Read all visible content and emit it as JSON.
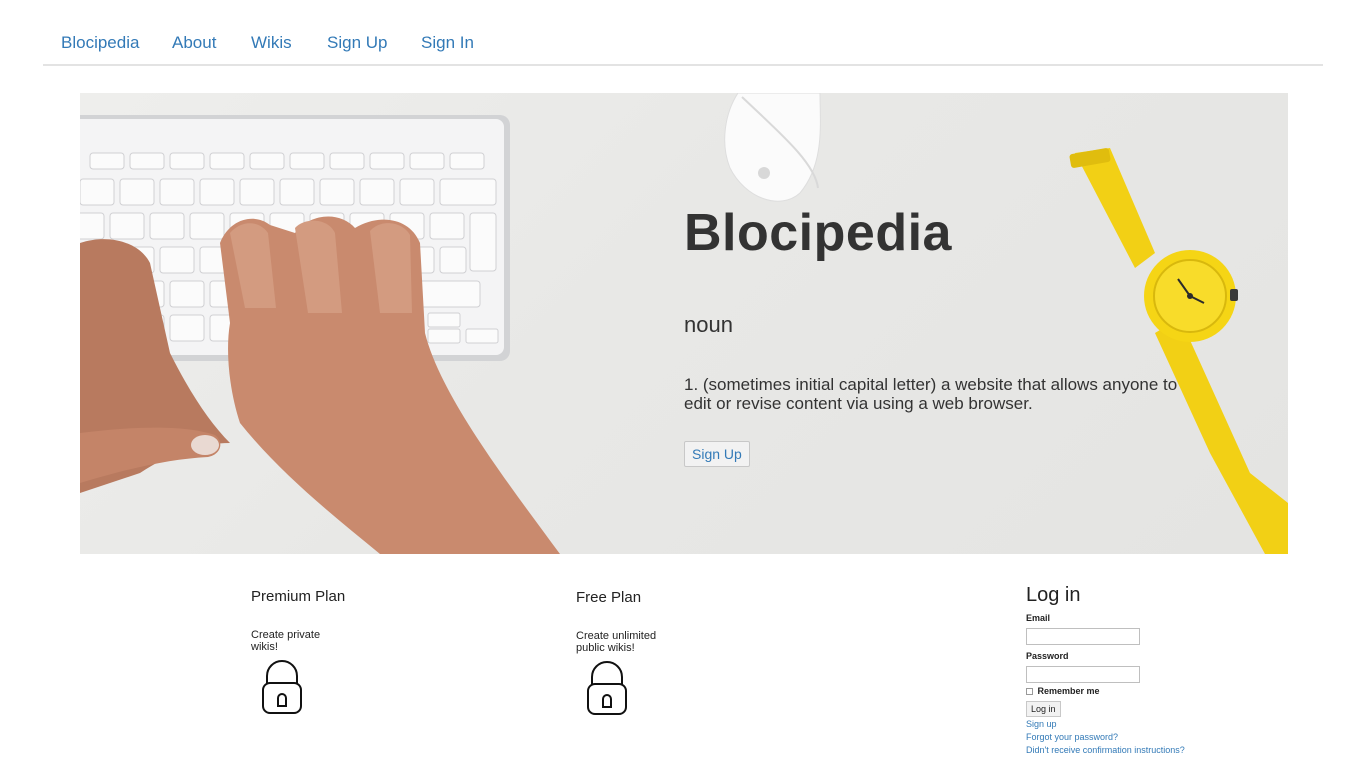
{
  "nav": {
    "brand": "Blocipedia",
    "items": [
      "About",
      "Wikis",
      "Sign Up",
      "Sign In"
    ]
  },
  "hero": {
    "title": "Blocipedia",
    "word_class": "noun",
    "definition": "1. (sometimes initial capital letter) a website that allows anyone to edit or revise content via using a web browser.",
    "button_label": "Sign Up"
  },
  "plans": [
    {
      "title": "Premium Plan",
      "description": "Create private wikis!",
      "icon": "lock-icon"
    },
    {
      "title": "Free Plan",
      "description": "Create unlimited public wikis!",
      "icon": "lock-icon"
    }
  ],
  "login": {
    "title": "Log in",
    "email_label": "Email",
    "email_value": "",
    "password_label": "Password",
    "password_value": "",
    "remember_label": "Remember me",
    "submit_label": "Log in",
    "links": [
      "Sign up",
      "Forgot your password?",
      "Didn't receive confirmation instructions?"
    ]
  },
  "colors": {
    "link": "#337ab7",
    "text": "#333333",
    "watch": "#f5d415"
  }
}
